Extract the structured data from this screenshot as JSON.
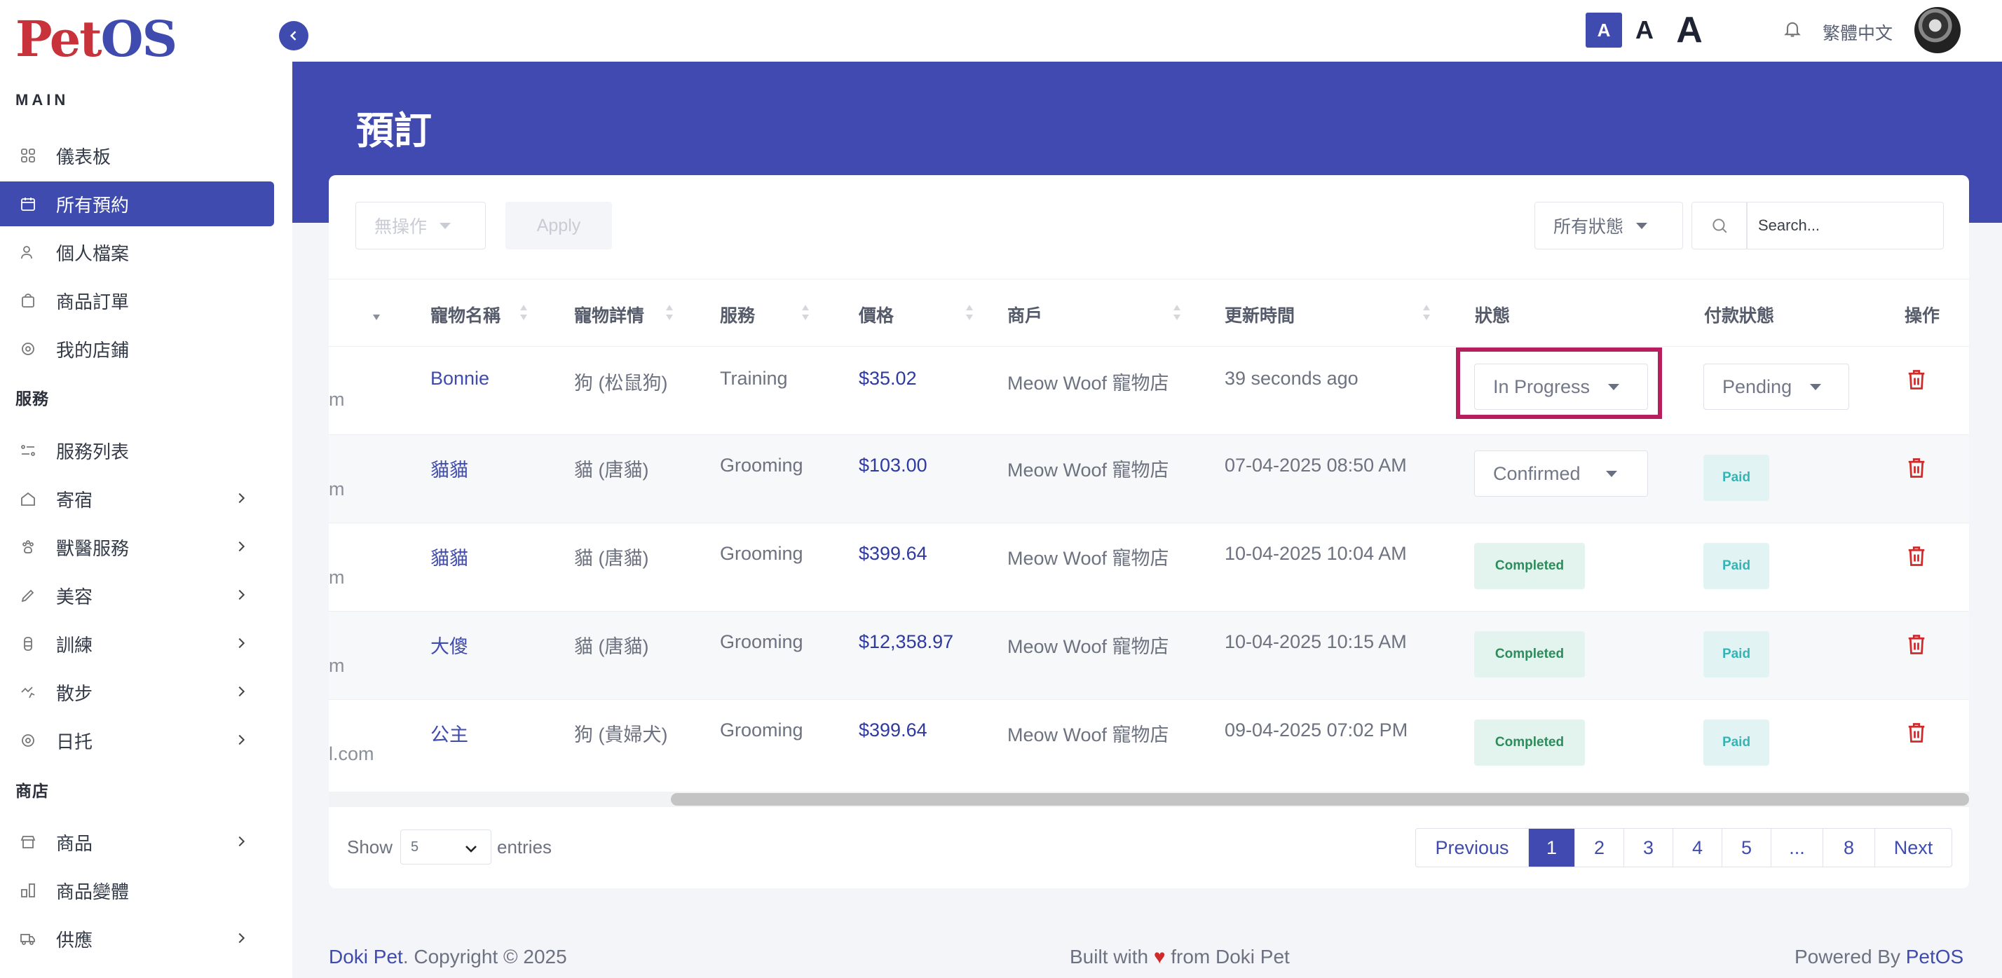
{
  "brand": {
    "logo_part1": "Pet",
    "logo_part2": "OS"
  },
  "sidebar": {
    "main_title": "MAIN",
    "services_title": "服務",
    "store_title": "商店",
    "items": [
      {
        "label": "儀表板",
        "icon": "grid-icon"
      },
      {
        "label": "所有預約",
        "icon": "calendar-icon",
        "active": true
      },
      {
        "label": "個人檔案",
        "icon": "user-icon"
      },
      {
        "label": "商品訂單",
        "icon": "bag-icon"
      },
      {
        "label": "我的店鋪",
        "icon": "store-icon"
      },
      {
        "label": "服務列表",
        "icon": "list-icon"
      },
      {
        "label": "寄宿",
        "icon": "house-icon"
      },
      {
        "label": "獸醫服務",
        "icon": "paw-icon"
      },
      {
        "label": "美容",
        "icon": "brush-icon"
      },
      {
        "label": "訓練",
        "icon": "bone-icon"
      },
      {
        "label": "散步",
        "icon": "walk-icon"
      },
      {
        "label": "日托",
        "icon": "daycare-icon"
      },
      {
        "label": "商品",
        "icon": "shop-icon"
      },
      {
        "label": "商品變體",
        "icon": "variant-icon"
      },
      {
        "label": "供應",
        "icon": "truck-icon"
      }
    ]
  },
  "topbar": {
    "font_small": "A",
    "font_medium": "A",
    "font_large": "A",
    "language": "繁體中文"
  },
  "page": {
    "title": "預訂"
  },
  "toolbar": {
    "bulk_action": "無操作",
    "apply": "Apply",
    "status_filter": "所有狀態",
    "search_placeholder": "Search..."
  },
  "table": {
    "headers": [
      "寵物名稱",
      "寵物詳情",
      "服務",
      "價格",
      "商戶",
      "更新時間",
      "狀態",
      "付款狀態",
      "操作"
    ],
    "rows": [
      {
        "email_tail": "m",
        "pet": "Bonnie",
        "details": "狗 (松鼠狗)",
        "service": "Training",
        "price": "$35.02",
        "merchant": "Meow Woof 寵物店",
        "updated": "39 seconds ago",
        "status": "In Progress",
        "status_type": "select",
        "payment": "Pending",
        "payment_type": "select"
      },
      {
        "email_tail": "m",
        "pet": "貓貓",
        "details": "貓 (唐貓)",
        "service": "Grooming",
        "price": "$103.00",
        "merchant": "Meow Woof 寵物店",
        "updated": "07-04-2025 08:50 AM",
        "status": "Confirmed",
        "status_type": "select",
        "payment": "Paid",
        "payment_type": "badge"
      },
      {
        "email_tail": "m",
        "pet": "貓貓",
        "details": "貓 (唐貓)",
        "service": "Grooming",
        "price": "$399.64",
        "merchant": "Meow Woof 寵物店",
        "updated": "10-04-2025 10:04 AM",
        "status": "Completed",
        "status_type": "badge",
        "payment": "Paid",
        "payment_type": "badge"
      },
      {
        "email_tail": "m",
        "pet": "大傻",
        "details": "貓 (唐貓)",
        "service": "Grooming",
        "price": "$12,358.97",
        "merchant": "Meow Woof 寵物店",
        "updated": "10-04-2025 10:15 AM",
        "status": "Completed",
        "status_type": "badge",
        "payment": "Paid",
        "payment_type": "badge"
      },
      {
        "email_tail": "l.com",
        "pet": "公主",
        "details": "狗 (貴婦犬)",
        "service": "Grooming",
        "price": "$399.64",
        "merchant": "Meow Woof 寵物店",
        "updated": "09-04-2025 07:02 PM",
        "status": "Completed",
        "status_type": "badge",
        "payment": "Paid",
        "payment_type": "badge"
      }
    ]
  },
  "pagination": {
    "show": "Show",
    "entries_value": "5",
    "entries": "entries",
    "previous": "Previous",
    "pages": [
      "1",
      "2",
      "3",
      "4",
      "5",
      "...",
      "8"
    ],
    "current": "1",
    "next": "Next"
  },
  "footer": {
    "brand": "Doki Pet",
    "copyright": ". Copyright © 2025",
    "built_pre": "Built with",
    "built_post": "from Doki Pet",
    "powered_pre": "Powered By",
    "powered_brand": "PetOS"
  },
  "colors": {
    "primary": "#404ab0",
    "danger": "#d02b2b",
    "highlight": "#b61e5e",
    "completed": "#2c8c5b",
    "paid": "#35b3b5"
  }
}
